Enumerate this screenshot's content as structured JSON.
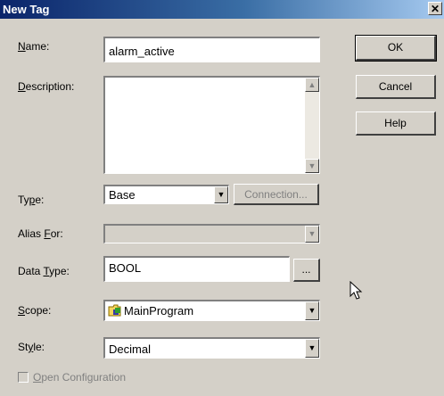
{
  "window": {
    "title": "New Tag",
    "close_glyph": "✕"
  },
  "fields": {
    "name": {
      "label": "Name:",
      "value": "alarm_active"
    },
    "description": {
      "label": "Description:",
      "value": ""
    },
    "type": {
      "label": "Type:",
      "value": "Base"
    },
    "alias_for": {
      "label": "Alias For:",
      "value": ""
    },
    "data_type": {
      "label": "Data Type:",
      "value": "BOOL"
    },
    "scope": {
      "label": "Scope:",
      "value": "MainProgram",
      "icon": "program-folder-icon"
    },
    "style": {
      "label": "Style:",
      "value": "Decimal"
    }
  },
  "buttons": {
    "ok": "OK",
    "cancel": "Cancel",
    "help": "Help",
    "connection": "Connection...",
    "browse": "..."
  },
  "checkbox": {
    "label": "Open Configuration",
    "checked": false
  }
}
